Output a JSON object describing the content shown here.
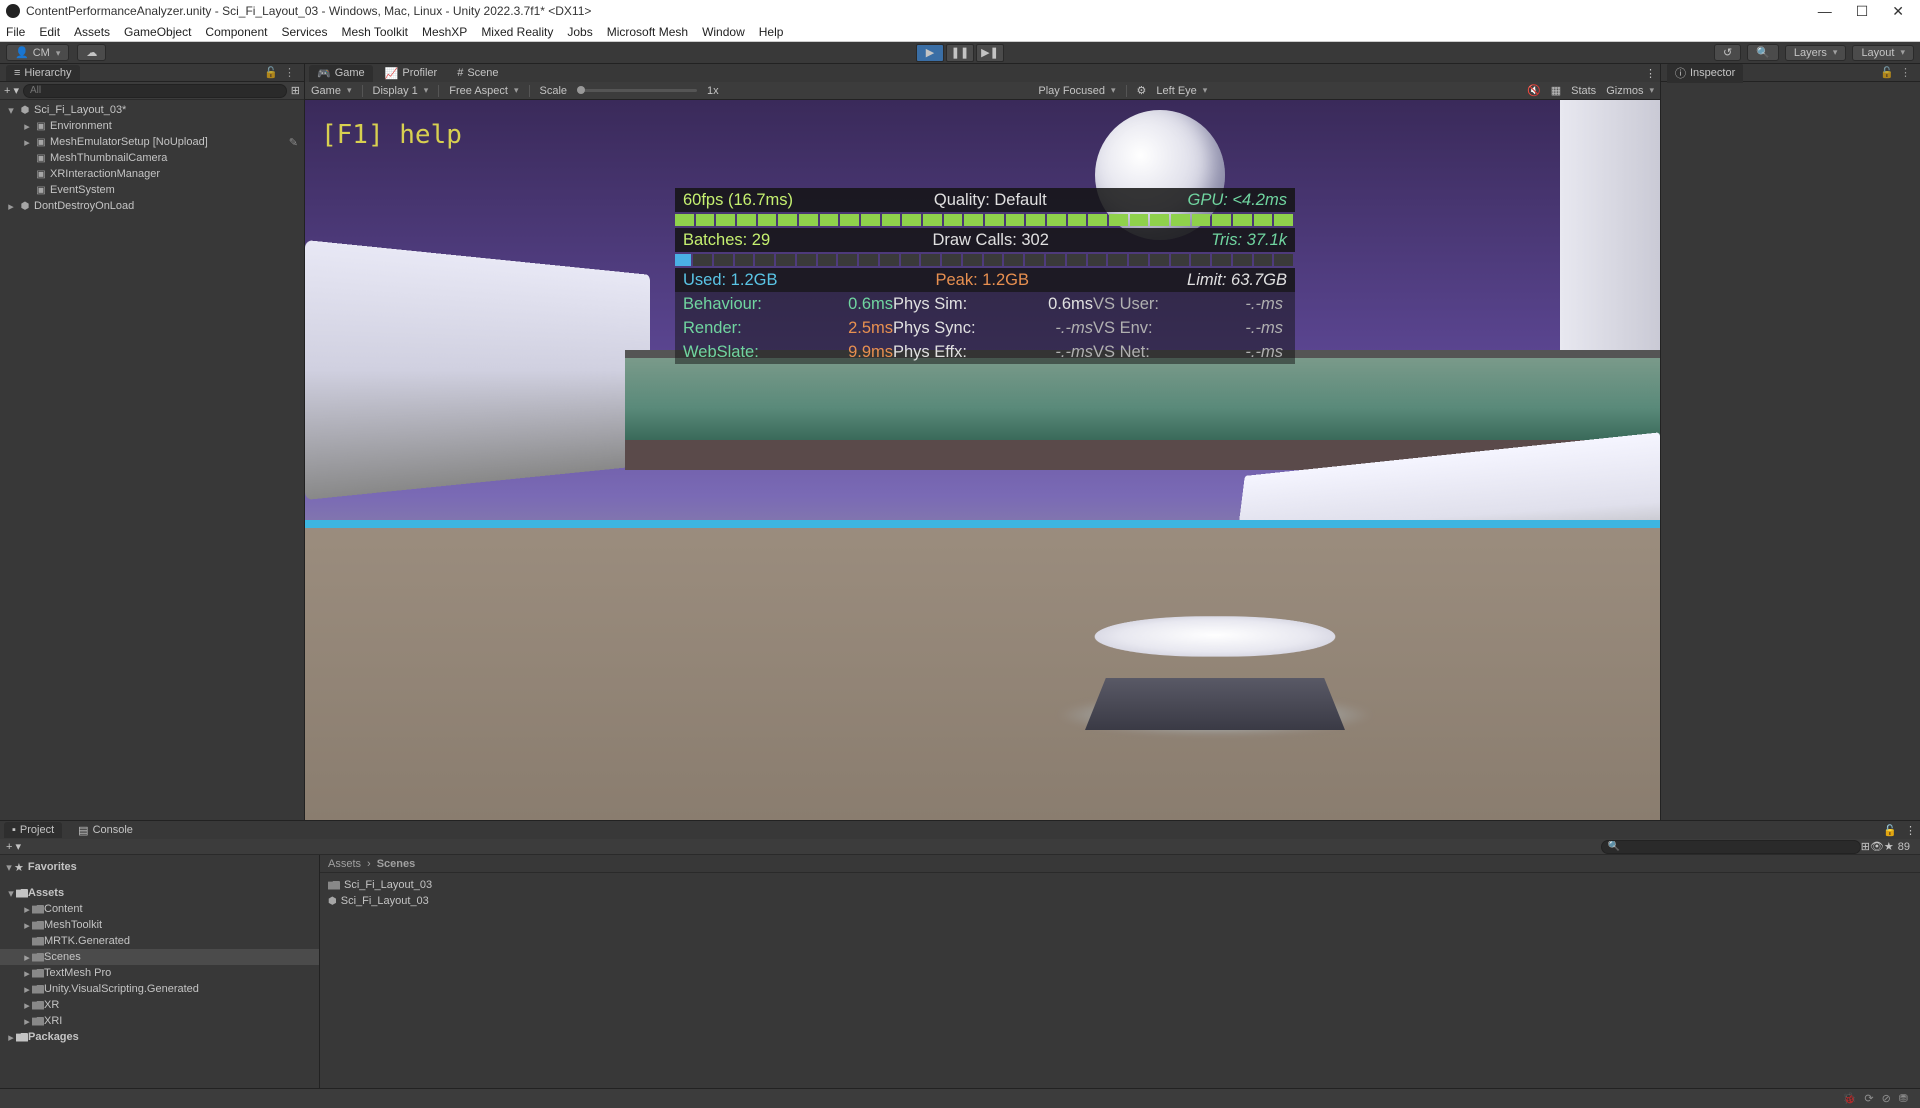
{
  "window": {
    "title": "ContentPerformanceAnalyzer.unity - Sci_Fi_Layout_03 - Windows, Mac, Linux - Unity 2022.3.7f1* <DX11>"
  },
  "menu": {
    "items": [
      "File",
      "Edit",
      "Assets",
      "GameObject",
      "Component",
      "Services",
      "Mesh Toolkit",
      "MeshXP",
      "Mixed Reality",
      "Jobs",
      "Microsoft Mesh",
      "Window",
      "Help"
    ]
  },
  "toolbar": {
    "account": "CM",
    "layers": "Layers",
    "layout": "Layout"
  },
  "hierarchy": {
    "title": "Hierarchy",
    "search_placeholder": "All",
    "items": [
      {
        "label": "Sci_Fi_Layout_03*",
        "depth": 0,
        "icon": "unity",
        "arrow": "▾"
      },
      {
        "label": "Environment",
        "depth": 1,
        "icon": "cube",
        "arrow": "▸"
      },
      {
        "label": "MeshEmulatorSetup [NoUpload]",
        "depth": 1,
        "icon": "cube",
        "arrow": "▸",
        "edit": true
      },
      {
        "label": "MeshThumbnailCamera",
        "depth": 1,
        "icon": "cube",
        "arrow": ""
      },
      {
        "label": "XRInteractionManager",
        "depth": 1,
        "icon": "cube",
        "arrow": ""
      },
      {
        "label": "EventSystem",
        "depth": 1,
        "icon": "cube",
        "arrow": ""
      },
      {
        "label": "DontDestroyOnLoad",
        "depth": 0,
        "icon": "unity",
        "arrow": "▸"
      }
    ]
  },
  "game": {
    "tabs": {
      "game": "Game",
      "profiler": "Profiler",
      "scene": "Scene"
    },
    "toolbar": {
      "mode": "Game",
      "display": "Display 1",
      "aspect": "Free Aspect",
      "scale_label": "Scale",
      "scale_value": "1x",
      "play_focused": "Play Focused",
      "left_eye": "Left Eye",
      "stats": "Stats",
      "gizmos": "Gizmos"
    },
    "help": "[F1] help",
    "perf": {
      "fps": "60fps (16.7ms)",
      "quality": "Quality: Default",
      "gpu": "GPU: <4.2ms",
      "batches": "Batches: 29",
      "drawcalls": "Draw Calls: 302",
      "tris": "Tris: 37.1k",
      "used": "Used: 1.2GB",
      "peak": "Peak: 1.2GB",
      "limit": "Limit: 63.7GB",
      "behaviour_l": "Behaviour:",
      "behaviour_v": "0.6ms",
      "render_l": "Render:",
      "render_v": "2.5ms",
      "webslate_l": "WebSlate:",
      "webslate_v": "9.9ms",
      "physsim_l": "Phys Sim:",
      "physsim_v": "0.6ms",
      "physsync_l": "Phys Sync:",
      "physsync_v": "-.-ms",
      "physeffx_l": "Phys Effx:",
      "physeffx_v": "-.-ms",
      "vsuser_l": "VS User:",
      "vsuser_v": "-.-ms",
      "vsenv_l": "VS Env:",
      "vsenv_v": "-.-ms",
      "vsnet_l": "VS Net:",
      "vsnet_v": "-.-ms"
    }
  },
  "inspector": {
    "title": "Inspector"
  },
  "project": {
    "tabs": {
      "project": "Project",
      "console": "Console"
    },
    "favorites": "Favorites",
    "tree": [
      {
        "label": "Assets",
        "depth": 0,
        "arrow": "▾",
        "bold": true
      },
      {
        "label": "Content",
        "depth": 1,
        "arrow": "▸"
      },
      {
        "label": "MeshToolkit",
        "depth": 1,
        "arrow": "▸"
      },
      {
        "label": "MRTK.Generated",
        "depth": 1,
        "arrow": ""
      },
      {
        "label": "Scenes",
        "depth": 1,
        "arrow": "▸",
        "selected": true
      },
      {
        "label": "TextMesh Pro",
        "depth": 1,
        "arrow": "▸"
      },
      {
        "label": "Unity.VisualScripting.Generated",
        "depth": 1,
        "arrow": "▸"
      },
      {
        "label": "XR",
        "depth": 1,
        "arrow": "▸"
      },
      {
        "label": "XRI",
        "depth": 1,
        "arrow": "▸"
      },
      {
        "label": "Packages",
        "depth": 0,
        "arrow": "▸",
        "bold": true
      }
    ],
    "breadcrumb": {
      "root": "Assets",
      "current": "Scenes"
    },
    "assets": [
      {
        "label": "Sci_Fi_Layout_03",
        "icon": "folder"
      },
      {
        "label": "Sci_Fi_Layout_03",
        "icon": "unity"
      }
    ],
    "slider_count": "89"
  }
}
